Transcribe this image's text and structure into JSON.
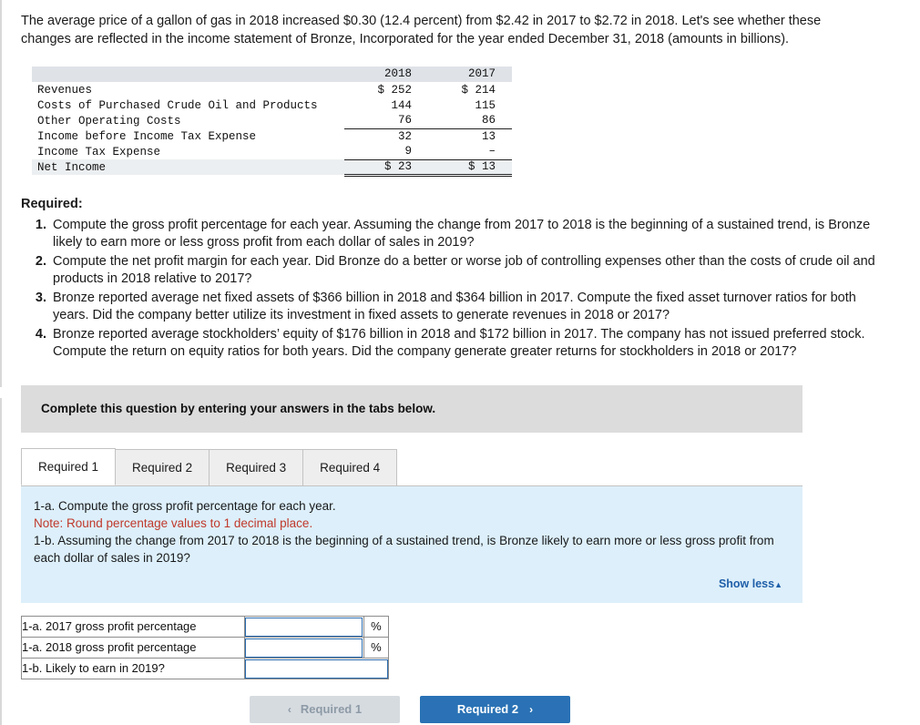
{
  "intro": "The average price of a gallon of gas in 2018 increased $0.30 (12.4 percent) from $2.42 in 2017 to $2.72 in 2018. Let's see whether these changes are reflected in the income statement of Bronze, Incorporated for the year ended December 31, 2018 (amounts in billions).",
  "financials": {
    "col_headers": [
      "2018",
      "2017"
    ],
    "rows": [
      {
        "label": "Revenues",
        "v2018": "$ 252",
        "v2017": "$ 214"
      },
      {
        "label": "Costs of Purchased Crude Oil and Products",
        "v2018": "144",
        "v2017": "115"
      },
      {
        "label": "Other Operating Costs",
        "v2018": "76",
        "v2017": "86"
      },
      {
        "label": "Income before Income Tax Expense",
        "v2018": "32",
        "v2017": "13"
      },
      {
        "label": "Income Tax Expense",
        "v2018": "9",
        "v2017": "–"
      },
      {
        "label": "Net Income",
        "v2018": "$  23",
        "v2017": "$  13"
      }
    ]
  },
  "required": {
    "heading": "Required:",
    "items": [
      "Compute the gross profit percentage for each year. Assuming the change from 2017 to 2018 is the beginning of a sustained trend, is Bronze likely to earn more or less gross profit from each dollar of sales in 2019?",
      "Compute the net profit margin for each year. Did Bronze do a better or worse job of controlling expenses other than the costs of crude oil and products in 2018 relative to 2017?",
      "Bronze reported average net fixed assets of $366 billion in 2018 and $364 billion in 2017. Compute the fixed asset turnover ratios for both years. Did the company better utilize its investment in fixed assets to generate revenues in 2018 or 2017?",
      "Bronze reported average stockholders’ equity of $176 billion in 2018 and $172 billion in 2017. The company has not issued preferred stock. Compute the return on equity ratios for both years. Did the company generate greater returns for stockholders in 2018 or 2017?"
    ]
  },
  "instruction_bar": "Complete this question by entering your answers in the tabs below.",
  "tabs": [
    {
      "label": "Required 1",
      "active": true
    },
    {
      "label": "Required 2",
      "active": false
    },
    {
      "label": "Required 3",
      "active": false
    },
    {
      "label": "Required 4",
      "active": false
    }
  ],
  "prompt": {
    "line1": "1-a. Compute the gross profit percentage for each year.",
    "note": "Note: Round percentage values to 1 decimal place.",
    "line2": "1-b. Assuming the change from 2017 to 2018 is the beginning of a sustained trend, is Bronze likely to earn more or less gross profit from each dollar of sales in 2019?",
    "show_less": "Show less",
    "show_less_caret": "▲"
  },
  "answers": {
    "rows": [
      {
        "label": "1-a. 2017 gross profit percentage",
        "value": "",
        "unit": "%"
      },
      {
        "label": "1-a. 2018 gross profit percentage",
        "value": "",
        "unit": "%"
      },
      {
        "label": "1-b. Likely to earn in 2019?",
        "value": "",
        "unit": ""
      }
    ]
  },
  "nav": {
    "prev_label": "Required 1",
    "prev_caret": "‹",
    "next_label": "Required 2",
    "next_caret": "›"
  }
}
